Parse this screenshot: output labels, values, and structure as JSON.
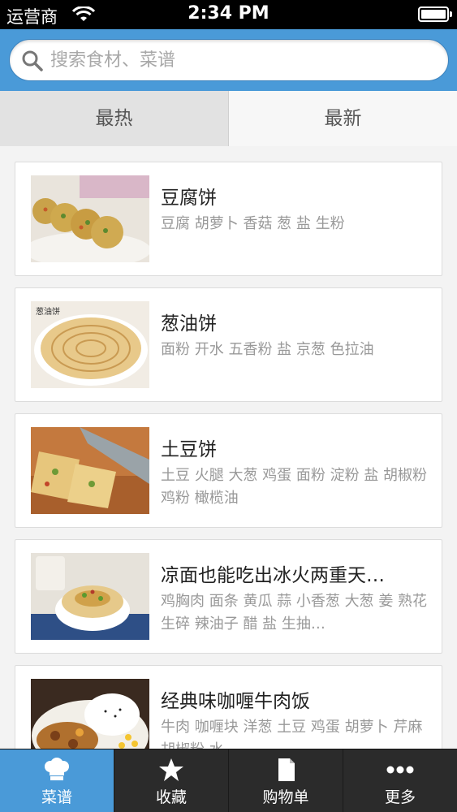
{
  "status_bar": {
    "carrier": "运营商",
    "time": "2:34 PM"
  },
  "search": {
    "placeholder": "搜索食材、菜谱"
  },
  "tabs": [
    {
      "label": "最热"
    },
    {
      "label": "最新"
    }
  ],
  "recipes": [
    {
      "title": "豆腐饼",
      "ingredients": "豆腐 胡萝卜 香菇 葱 盐 生粉"
    },
    {
      "title": "葱油饼",
      "ingredients": "面粉 开水 五香粉 盐 京葱 色拉油"
    },
    {
      "title": "土豆饼",
      "ingredients": "土豆 火腿 大葱 鸡蛋 面粉 淀粉 盐 胡椒粉 鸡粉 橄榄油"
    },
    {
      "title": "凉面也能吃出冰火两重天…",
      "ingredients": "鸡胸肉 面条 黄瓜 蒜 小香葱 大葱 姜 熟花生碎 辣油子 醋 盐 生抽…"
    },
    {
      "title": "经典味咖喱牛肉饭",
      "ingredients": "牛肉 咖喱块 洋葱 土豆 鸡蛋 胡萝卜 芹麻 胡椒粉 水"
    }
  ],
  "tabbar": [
    {
      "label": "菜谱",
      "icon": "chef-hat-icon"
    },
    {
      "label": "收藏",
      "icon": "star-icon"
    },
    {
      "label": "购物单",
      "icon": "document-icon"
    },
    {
      "label": "更多",
      "icon": "more-dots-icon"
    }
  ],
  "colors": {
    "accent": "#4a9ad8",
    "tabbar": "#2b2b2b"
  }
}
